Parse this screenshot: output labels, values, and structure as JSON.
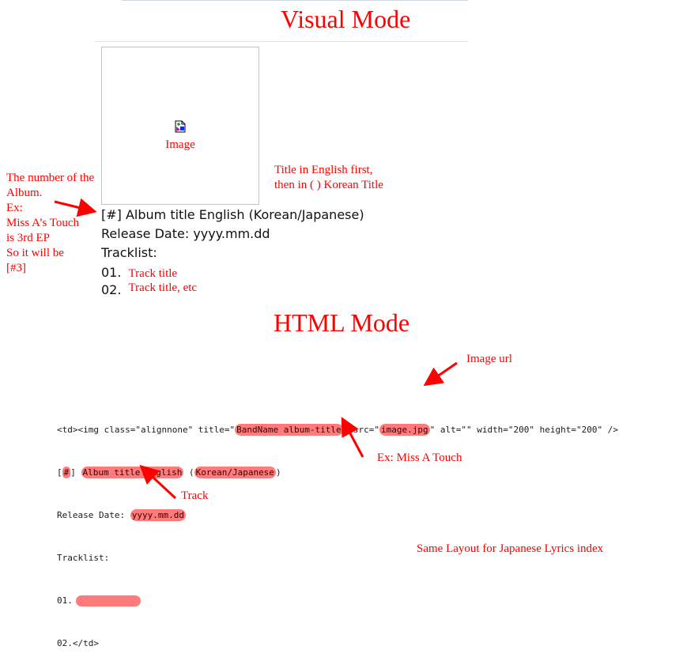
{
  "visual_mode": {
    "heading": "Visual Mode",
    "image_placeholder_label": "Image",
    "album_line": "[#] Album title English (Korean/Japanese)",
    "release_date_line": "Release Date: yyyy.mm.dd",
    "tracklist_label": "Tracklist:",
    "tracks": [
      {
        "number": "01.",
        "title": "Track title"
      },
      {
        "number": "02.",
        "title": "Track title, etc"
      }
    ]
  },
  "annotations": {
    "album_number_note": [
      "The number of the",
      "Album.",
      "Ex:",
      "Miss A’s Touch",
      "is 3rd EP",
      "So it will be",
      "[#3]"
    ],
    "title_note": [
      "Title in English first,",
      "then in ( ) Korean Title"
    ],
    "image_url_note": "Image url",
    "example_note": "Ex: Miss A Touch",
    "track_note": "Track",
    "footer_note": "Same Layout for Japanese Lyrics index"
  },
  "html_mode": {
    "heading": "HTML Mode",
    "line1": {
      "pre": "<td><img class=\"alignnone\" title=\"",
      "title_value": "BandName album-title",
      "mid": "\" src=\"",
      "src_value": "image.jpg",
      "post": "\" alt=\"\" width=\"200\" height=\"200\" />"
    },
    "line2": {
      "open": "[",
      "number": "#",
      "close": "] ",
      "english_title": "Album title English",
      "paren_open": " (",
      "native_title": "Korean/Japanese",
      "paren_close": ")"
    },
    "line3": {
      "label": "Release Date: ",
      "value": "yyyy.mm.dd"
    },
    "line4": "Tracklist:",
    "line5": "01.",
    "line6": "02.</td>"
  },
  "colors": {
    "annotation": "#ff0000",
    "highlight": "#ff4646"
  }
}
